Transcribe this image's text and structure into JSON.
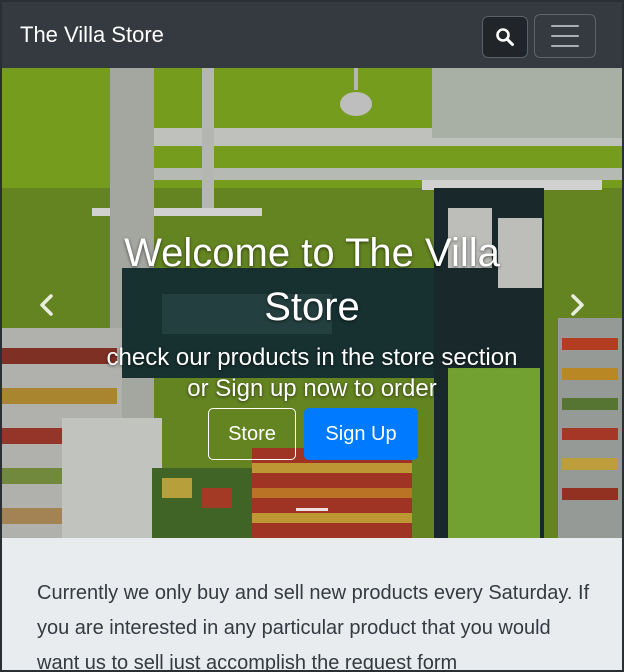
{
  "navbar": {
    "brand": "The Villa Store",
    "search_icon": "search-icon",
    "menu_icon": "hamburger-menu-icon"
  },
  "hero": {
    "title": "Welcome to The Villa Store",
    "subtitle": "check our products in the store section or Sign up now to order",
    "store_button": "Store",
    "signup_button": "Sign Up",
    "prev_icon": "chevron-left-icon",
    "next_icon": "chevron-right-icon",
    "active_slide": 1,
    "slide_count": 1
  },
  "info": {
    "text": "Currently we only buy and sell new products every Saturday. If you are interested in any particular product that you would want us to sell just accomplish the request form"
  },
  "colors": {
    "navbar_bg": "#343a40",
    "primary": "#007bff",
    "page_bg": "#e9ecef"
  }
}
